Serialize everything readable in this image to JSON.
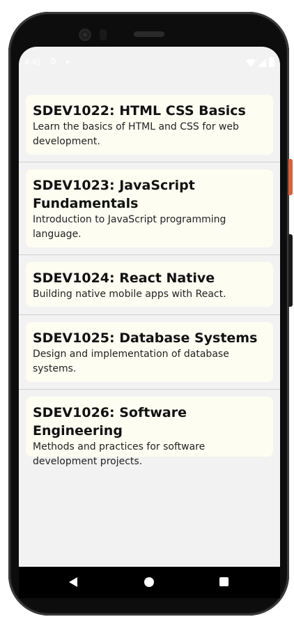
{
  "status_bar": {
    "time": "4:45",
    "icons": [
      "settings-gear-icon",
      "notification-dot-icon",
      "wifi-icon",
      "cell-signal-icon",
      "battery-icon"
    ]
  },
  "courses": [
    {
      "title": "SDEV1022: HTML CSS Basics",
      "description": "Learn the basics of HTML and CSS for web development."
    },
    {
      "title": "SDEV1023: JavaScript Fundamentals",
      "description": "Introduction to JavaScript programming language."
    },
    {
      "title": "SDEV1024: React Native",
      "description": "Building native mobile apps with React."
    },
    {
      "title": "SDEV1025: Database Systems",
      "description": "Design and implementation of database systems."
    },
    {
      "title": "SDEV1026: Software Engineering",
      "description": "Methods and practices for software development projects."
    }
  ],
  "nav_bar": {
    "buttons": [
      "back-icon",
      "home-icon",
      "recents-icon"
    ]
  },
  "colors": {
    "card_background": "#fdfdf2",
    "screen_background": "#f2f2f2",
    "divider": "#cfcfcf",
    "device_frame": "#0d0d0d",
    "side_button_accent": "#d9603b"
  }
}
